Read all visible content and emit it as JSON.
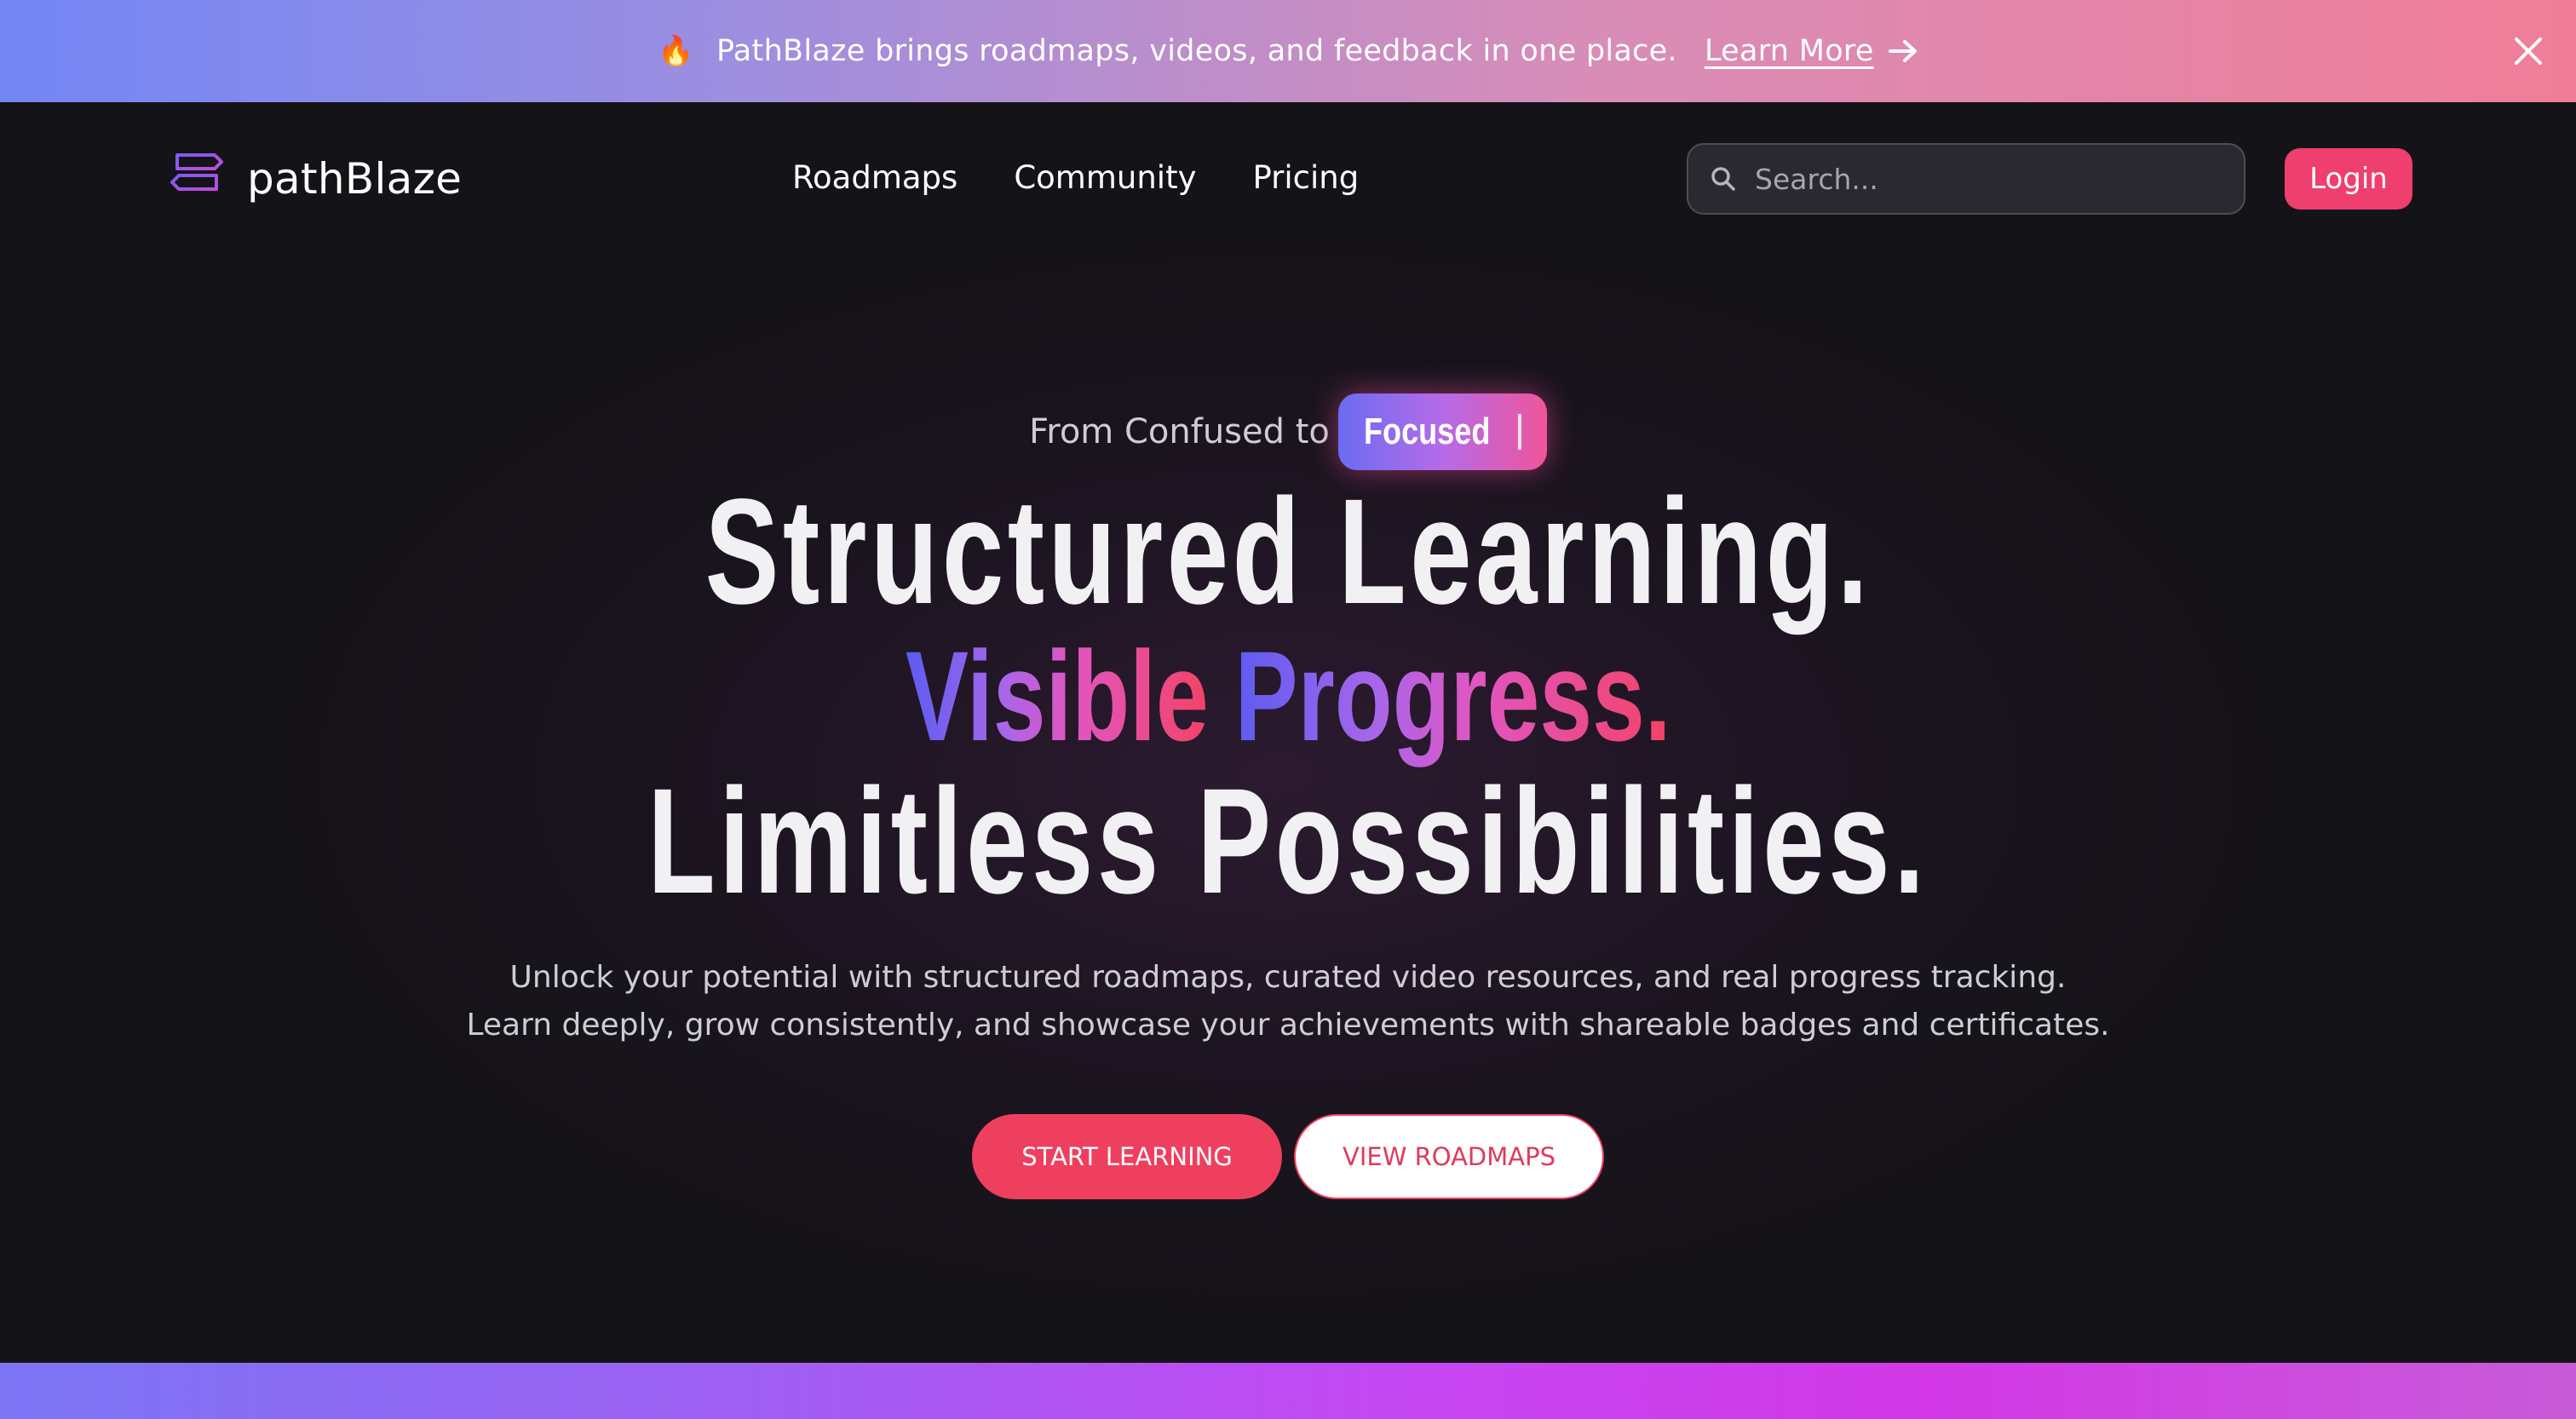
{
  "announcement": {
    "icon": "fire-icon",
    "text": "PathBlaze brings roadmaps, videos, and feedback in one place.",
    "link_label": "Learn More"
  },
  "nav": {
    "logo_text": "pathBlaze",
    "links": [
      "Roadmaps",
      "Community",
      "Pricing"
    ],
    "search_placeholder": "Search...",
    "login_label": "Login"
  },
  "hero": {
    "tagline_prefix": "From Confused to",
    "tagline_highlight": "Focused",
    "headline_line1": "Structured Learning.",
    "headline_line2_part1": "Visible",
    "headline_line2_part2": "Progress.",
    "headline_line3": "Limitless Possibilities.",
    "subtext_line1": "Unlock your potential with structured roadmaps, curated video resources, and real progress tracking.",
    "subtext_line2": "Learn deeply, grow consistently, and showcase your achievements with shareable badges and certificates.",
    "cta_primary": "START LEARNING",
    "cta_secondary": "VIEW ROADMAPS"
  },
  "colors": {
    "accent": "#ef3f5f",
    "background": "#141317",
    "gradient_start": "#5c5cf0",
    "gradient_end": "#f24367"
  }
}
